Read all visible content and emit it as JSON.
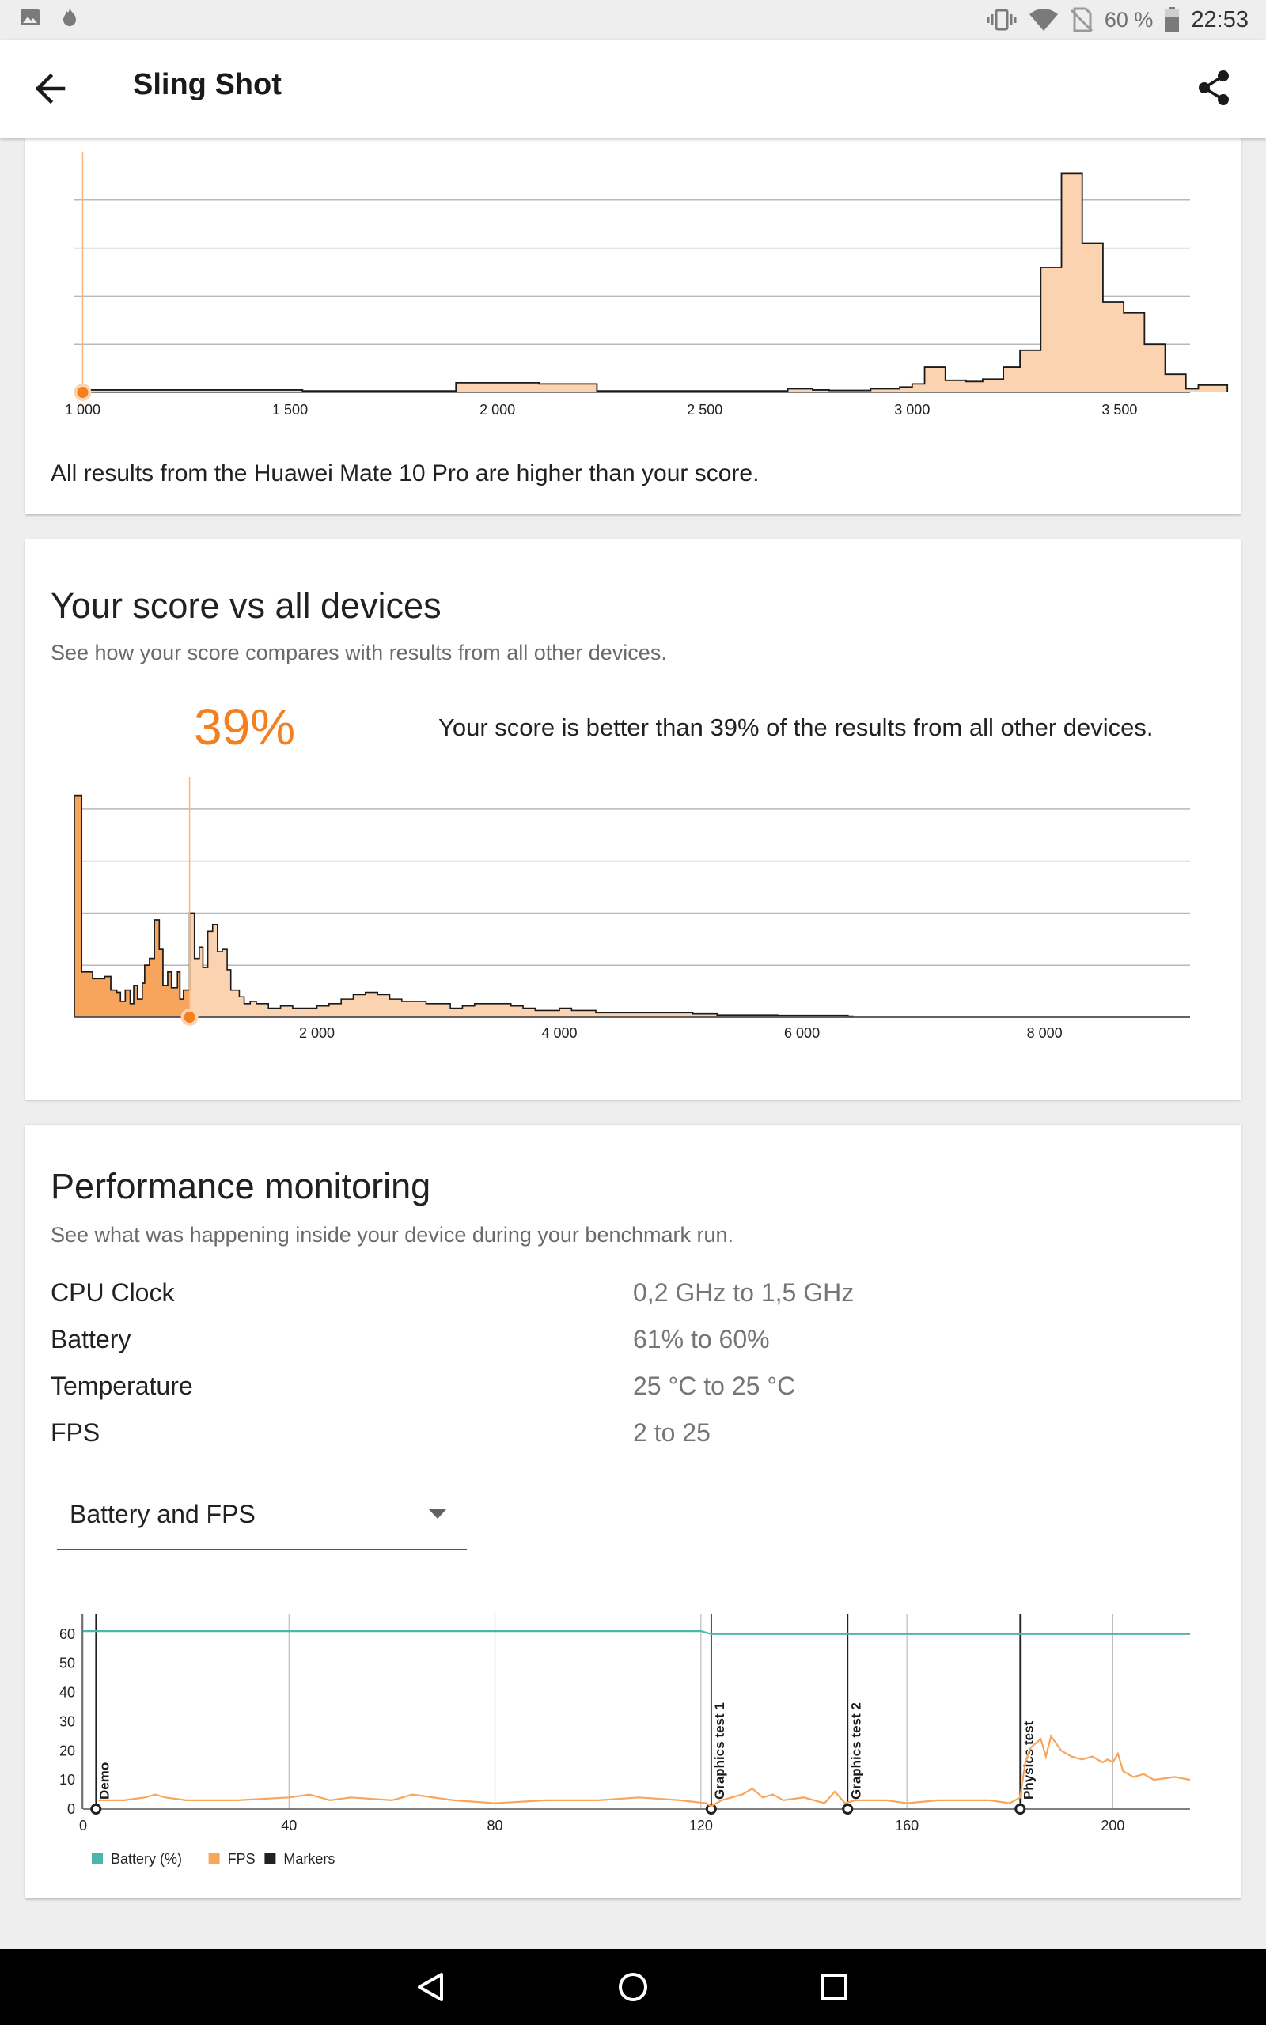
{
  "status_bar": {
    "battery_percent": "60 %",
    "time": "22:53",
    "icons": [
      "image-icon",
      "fire-icon",
      "vibrate-icon",
      "wifi-icon",
      "no-sim-icon",
      "battery-icon"
    ]
  },
  "app_bar": {
    "title": "Sling Shot",
    "back_icon": "arrow-left-icon",
    "share_icon": "share-icon"
  },
  "device_card": {
    "note": "All results from the Huawei Mate 10 Pro are higher than your score."
  },
  "score_card": {
    "title": "Your score vs all devices",
    "subtitle": "See how your score compares with results from all other devices.",
    "percent": "39%",
    "percent_text": "Your score is better than 39% of the results from all other devices."
  },
  "performance": {
    "title": "Performance monitoring",
    "subtitle": "See what was happening inside your device during your benchmark run.",
    "metrics": [
      {
        "label": "CPU Clock",
        "value": "0,2 GHz to 1,5 GHz"
      },
      {
        "label": "Battery",
        "value": "61% to 60%"
      },
      {
        "label": "Temperature",
        "value": "25 °C to 25 °C"
      },
      {
        "label": "FPS",
        "value": "2 to 25"
      }
    ],
    "dropdown_value": "Battery and FPS"
  },
  "colors": {
    "accent_orange": "#f47f1f",
    "histogram_fill": "#fcd3b0",
    "histogram_dark_fill": "#f7a45c",
    "battery_line": "#4db6ac",
    "fps_line": "#f9a55a",
    "marker": "#212121"
  },
  "chart_data": [
    {
      "type": "area",
      "xlim": [
        980,
        3670
      ],
      "x_ticks": [
        1000,
        1500,
        2000,
        2500,
        3000,
        3500
      ],
      "x_tick_labels": [
        "1 000",
        "1 500",
        "2 000",
        "2 500",
        "3 000",
        "3 500"
      ],
      "your_score": 1000,
      "ylim": [
        0,
        100
      ],
      "grid": true,
      "bins": [
        [
          980,
          1010,
          0.3
        ],
        [
          1010,
          1110,
          1
        ],
        [
          1110,
          1530,
          1
        ],
        [
          1530,
          1900,
          0.6
        ],
        [
          1900,
          2100,
          4
        ],
        [
          2100,
          2240,
          3.5
        ],
        [
          2240,
          2700,
          0.6
        ],
        [
          2700,
          2760,
          1.5
        ],
        [
          2760,
          2800,
          1
        ],
        [
          2800,
          2900,
          0.8
        ],
        [
          2900,
          2970,
          1.5
        ],
        [
          2970,
          3000,
          2.2
        ],
        [
          3000,
          3030,
          3.5
        ],
        [
          3030,
          3080,
          10.5
        ],
        [
          3080,
          3130,
          5
        ],
        [
          3130,
          3170,
          4.5
        ],
        [
          3170,
          3220,
          5.5
        ],
        [
          3220,
          3260,
          10.5
        ],
        [
          3260,
          3310,
          17.5
        ],
        [
          3310,
          3360,
          52
        ],
        [
          3360,
          3410,
          91
        ],
        [
          3410,
          3460,
          62
        ],
        [
          3460,
          3510,
          37.5
        ],
        [
          3510,
          3560,
          33
        ],
        [
          3560,
          3610,
          20
        ],
        [
          3610,
          3660,
          7.5
        ],
        [
          3660,
          3690,
          1.5
        ],
        [
          3690,
          3760,
          3
        ]
      ]
    },
    {
      "type": "area",
      "xlim": [
        0,
        9200
      ],
      "x_ticks": [
        2000,
        4000,
        6000,
        8000
      ],
      "x_tick_labels": [
        "2 000",
        "4 000",
        "6 000",
        "8 000"
      ],
      "your_score": 950,
      "ylim": [
        0,
        100
      ],
      "grid": true,
      "points": [
        [
          0,
          98
        ],
        [
          60,
          20
        ],
        [
          150,
          17
        ],
        [
          250,
          18
        ],
        [
          300,
          12
        ],
        [
          350,
          11
        ],
        [
          380,
          7
        ],
        [
          420,
          12
        ],
        [
          460,
          6
        ],
        [
          490,
          14
        ],
        [
          520,
          8
        ],
        [
          560,
          15
        ],
        [
          580,
          23
        ],
        [
          620,
          26
        ],
        [
          660,
          43
        ],
        [
          700,
          30
        ],
        [
          730,
          14
        ],
        [
          770,
          20
        ],
        [
          800,
          13
        ],
        [
          850,
          20
        ],
        [
          870,
          8
        ],
        [
          900,
          12
        ],
        [
          950,
          46
        ],
        [
          990,
          26
        ],
        [
          1030,
          31
        ],
        [
          1060,
          22
        ],
        [
          1100,
          38
        ],
        [
          1140,
          41
        ],
        [
          1180,
          29
        ],
        [
          1220,
          30
        ],
        [
          1260,
          21
        ],
        [
          1290,
          12
        ],
        [
          1330,
          12
        ],
        [
          1360,
          9
        ],
        [
          1400,
          6
        ],
        [
          1450,
          7
        ],
        [
          1500,
          6
        ],
        [
          1600,
          4
        ],
        [
          1700,
          5
        ],
        [
          1800,
          4
        ],
        [
          1900,
          4
        ],
        [
          2000,
          5
        ],
        [
          2100,
          6
        ],
        [
          2200,
          8
        ],
        [
          2300,
          10
        ],
        [
          2400,
          11
        ],
        [
          2500,
          10
        ],
        [
          2600,
          8
        ],
        [
          2700,
          7
        ],
        [
          2800,
          7
        ],
        [
          2900,
          6
        ],
        [
          3000,
          6
        ],
        [
          3100,
          4
        ],
        [
          3200,
          5
        ],
        [
          3300,
          6
        ],
        [
          3400,
          6
        ],
        [
          3500,
          6
        ],
        [
          3600,
          5
        ],
        [
          3700,
          4
        ],
        [
          3800,
          3
        ],
        [
          3900,
          3
        ],
        [
          4000,
          4
        ],
        [
          4100,
          3
        ],
        [
          4200,
          3
        ],
        [
          4300,
          2
        ],
        [
          4500,
          2
        ],
        [
          4700,
          2
        ],
        [
          4900,
          2
        ],
        [
          5100,
          1.5
        ],
        [
          5300,
          1
        ],
        [
          5600,
          1
        ],
        [
          5800,
          0.8
        ],
        [
          6000,
          0.8
        ],
        [
          6200,
          0.8
        ],
        [
          6380,
          0.5
        ],
        [
          6420,
          0
        ],
        [
          9200,
          0
        ]
      ]
    },
    {
      "type": "line",
      "x_ticks": [
        0,
        40,
        80,
        120,
        160,
        200
      ],
      "xlim": [
        0,
        215
      ],
      "y_ticks": [
        0,
        10,
        20,
        30,
        40,
        50,
        60
      ],
      "ylim": [
        0,
        67
      ],
      "legend": [
        "Battery (%)",
        "FPS",
        "Markers"
      ],
      "legend_placement": "bottom-left",
      "markers": [
        {
          "x": 2.5,
          "label": "Demo"
        },
        {
          "x": 122,
          "label": "Graphics test 1"
        },
        {
          "x": 148.5,
          "label": "Graphics test 2"
        },
        {
          "x": 182,
          "label": "Physics test"
        }
      ],
      "series": [
        {
          "name": "Battery (%)",
          "values": [
            [
              0,
              61
            ],
            [
              120,
              61
            ],
            [
              122,
              60
            ],
            [
              215,
              60
            ]
          ]
        },
        {
          "name": "FPS",
          "values": [
            [
              3,
              3
            ],
            [
              8,
              3
            ],
            [
              12,
              4
            ],
            [
              14,
              5
            ],
            [
              16,
              4
            ],
            [
              20,
              3
            ],
            [
              30,
              3
            ],
            [
              40,
              4
            ],
            [
              44,
              5
            ],
            [
              48,
              3
            ],
            [
              52,
              4
            ],
            [
              60,
              3
            ],
            [
              64,
              5
            ],
            [
              68,
              4
            ],
            [
              72,
              3
            ],
            [
              80,
              2
            ],
            [
              90,
              3
            ],
            [
              100,
              3
            ],
            [
              108,
              4
            ],
            [
              116,
              3
            ],
            [
              121,
              2
            ],
            [
              122,
              1
            ],
            [
              124,
              3
            ],
            [
              128,
              5
            ],
            [
              130,
              7
            ],
            [
              132,
              4
            ],
            [
              134,
              5
            ],
            [
              136,
              3
            ],
            [
              140,
              4
            ],
            [
              144,
              2
            ],
            [
              146,
              6
            ],
            [
              148,
              2
            ],
            [
              150,
              3
            ],
            [
              156,
              3
            ],
            [
              160,
              2
            ],
            [
              166,
              3
            ],
            [
              172,
              3
            ],
            [
              176,
              3
            ],
            [
              180,
              2
            ],
            [
              182,
              4
            ],
            [
              183,
              16
            ],
            [
              184,
              21
            ],
            [
              186,
              24
            ],
            [
              187,
              18
            ],
            [
              188,
              25
            ],
            [
              190,
              20
            ],
            [
              192,
              18
            ],
            [
              194,
              17
            ],
            [
              196,
              18
            ],
            [
              198,
              16
            ],
            [
              199,
              17
            ],
            [
              200,
              16
            ],
            [
              201,
              19
            ],
            [
              202,
              13
            ],
            [
              204,
              11
            ],
            [
              206,
              12
            ],
            [
              208,
              10
            ],
            [
              212,
              11
            ],
            [
              215,
              10
            ]
          ]
        }
      ]
    }
  ]
}
